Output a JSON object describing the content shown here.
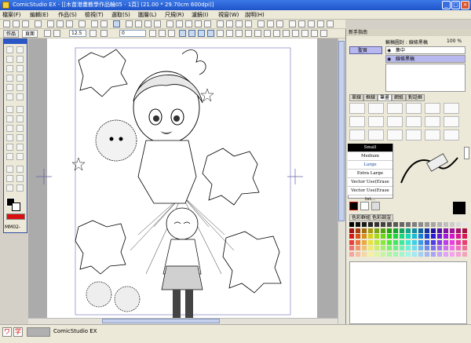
{
  "window": {
    "title": "ComicStudio EX - [[木苗港畫教學作品輪05 - 1頁] (21.00 * 29.70cm 600dpi)]",
    "min_label": "_",
    "max_label": "□",
    "close_label": "×"
  },
  "menu": {
    "items": [
      "檔案(F)",
      "編輯(E)",
      "作品(S)",
      "檢視(T)",
      "選取(S)",
      "圖層(L)",
      "尺規(R)",
      "濾鏡(I)",
      "視窗(W)",
      "說明(H)"
    ]
  },
  "toolbar": {
    "pen_size": "12.5",
    "count": "0",
    "zoom": "100"
  },
  "doc_tabs": [
    "作品",
    "頁面"
  ],
  "right_panel": {
    "title": "新手指南",
    "layer_header": "輸稿圖封 : 線條黑稿",
    "opacity": "100 %",
    "folder_name": "聖頁",
    "layers": [
      {
        "name": "集中"
      },
      {
        "name": "線條黑稿",
        "selected": true
      }
    ],
    "tool_tabs": [
      "單線",
      "框線",
      "筆畫",
      "網紙",
      "對話框"
    ],
    "active_tool_tab": "筆畫",
    "brush_sizes": [
      "Small",
      "Medium",
      "Large",
      "Extra Large",
      "Vector Use(Erase Fact)",
      "Vector Use(Erase Int..."
    ],
    "selected_brush_size": "Small",
    "color_tabs": [
      "色彩群組",
      "色彩調渲"
    ]
  },
  "tool_palette": {
    "label": "MM02-"
  },
  "statusbar": {
    "app_name": "ComicStudio EX"
  },
  "colors": {
    "titlebar": "#2a5fd6",
    "accent": "#2a56c8",
    "selected_layer": "#b8b8f0"
  }
}
